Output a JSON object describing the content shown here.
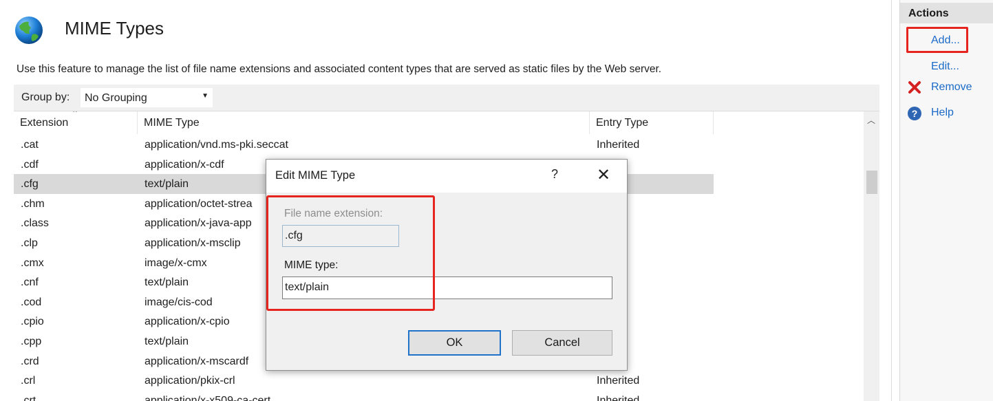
{
  "page": {
    "title": "MIME Types",
    "description": "Use this feature to manage the list of file name extensions and associated content types that are served as static files by the Web server."
  },
  "toolbar": {
    "group_by_label": "Group by:",
    "group_by_value": "No Grouping"
  },
  "grid": {
    "columns": [
      "Extension",
      "MIME Type",
      "Entry Type"
    ],
    "rows": [
      {
        "extension": ".cat",
        "mime": "application/vnd.ms-pki.seccat",
        "entry": "Inherited"
      },
      {
        "extension": ".cdf",
        "mime": "application/x-cdf",
        "entry": "ted"
      },
      {
        "extension": ".cfg",
        "mime": "text/plain",
        "entry": ""
      },
      {
        "extension": ".chm",
        "mime": "application/octet-strea",
        "entry": "ted"
      },
      {
        "extension": ".class",
        "mime": "application/x-java-app",
        "entry": "ted"
      },
      {
        "extension": ".clp",
        "mime": "application/x-msclip",
        "entry": "ted"
      },
      {
        "extension": ".cmx",
        "mime": "image/x-cmx",
        "entry": "ted"
      },
      {
        "extension": ".cnf",
        "mime": "text/plain",
        "entry": "ted"
      },
      {
        "extension": ".cod",
        "mime": "image/cis-cod",
        "entry": "ted"
      },
      {
        "extension": ".cpio",
        "mime": "application/x-cpio",
        "entry": "ted"
      },
      {
        "extension": ".cpp",
        "mime": "text/plain",
        "entry": "ted"
      },
      {
        "extension": ".crd",
        "mime": "application/x-mscardf",
        "entry": "ted"
      },
      {
        "extension": ".crl",
        "mime": "application/pkix-crl",
        "entry": "Inherited"
      },
      {
        "extension": ".crt",
        "mime": "application/x-x509-ca-cert",
        "entry": "Inherited"
      }
    ],
    "selected_index": 2
  },
  "actions": {
    "title": "Actions",
    "add": "Add...",
    "edit": "Edit...",
    "remove": "Remove",
    "help": "Help"
  },
  "dialog": {
    "title": "Edit MIME Type",
    "help_glyph": "?",
    "close_glyph": "✕",
    "extension_label": "File name extension:",
    "extension_value": ".cfg",
    "mime_label": "MIME type:",
    "mime_value": "text/plain",
    "ok_label": "OK",
    "cancel_label": "Cancel"
  },
  "colors": {
    "highlight": "#e5231f",
    "link": "#1b6ac9",
    "selected_row": "#d9d9d9"
  }
}
